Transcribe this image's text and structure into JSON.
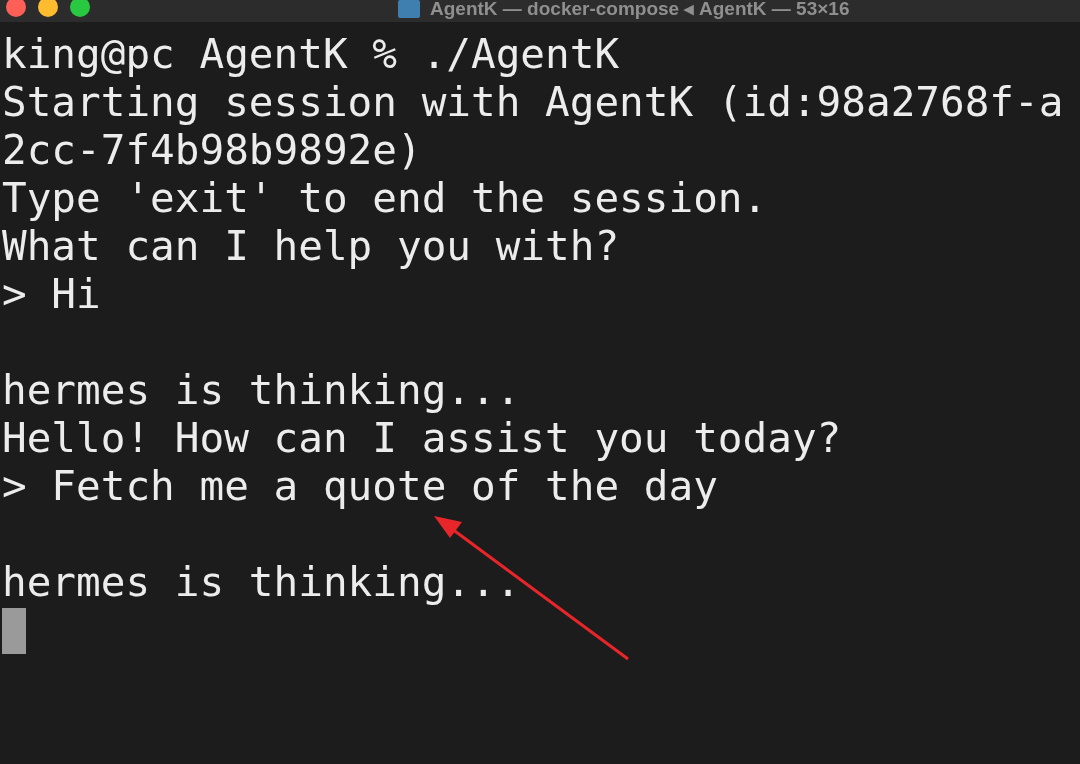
{
  "window": {
    "title": "AgentK — docker-compose ◂ AgentK — 53×16"
  },
  "terminal": {
    "blocks": [
      [
        "king@pc AgentK % ./AgentK",
        "Starting session with AgentK (id:98a2768f-a",
        "2cc-7f4b98b9892e)",
        "Type 'exit' to end the session.",
        "What can I help you with?",
        "> Hi"
      ],
      [
        "hermes is thinking...",
        "Hello! How can I assist you today?",
        "> Fetch me a quote of the day"
      ],
      [
        "hermes is thinking..."
      ]
    ],
    "cursor": true
  }
}
